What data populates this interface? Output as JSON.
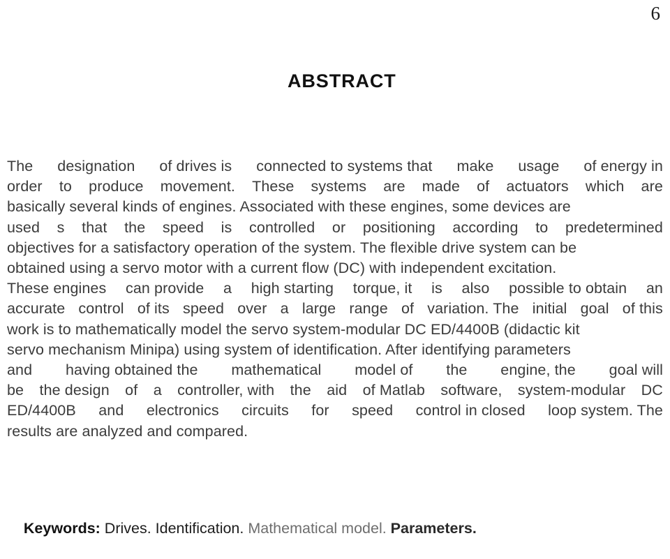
{
  "page": {
    "number": "6"
  },
  "heading": {
    "title": "ABSTRACT"
  },
  "abstract": {
    "lines": [
      "The   designation   of drives is   connected to systems that   make   usage   of energy in",
      "order  to  produce  movement.  These  systems  are  made  of  actuators  which  are",
      "basically several kinds of engines. Associated with these engines, some devices are",
      "used  s  that  the  speed  is  controlled  or  positioning  according  to  predetermined",
      "objectives for a satisfactory operation of the system. The flexible drive system can be",
      "obtained using a servo motor with a current flow (DC) with independent excitation.",
      "These engines  can provide  a  high starting  torque, it  is  also  possible to obtain  an",
      "accurate  control  of its  speed  over  a  large  range  of  variation. The  initial  goal  of this",
      "work is to mathematically model the servo system-modular DC ED/4400B (didactic kit",
      "servo mechanism Minipa) using system of identification. After identifying parameters",
      "and   having obtained the   mathematical   model of   the   engine, the   goal will",
      "be  the design  of  a  controller, with  the  aid  of Matlab  software,  system-modular  DC",
      "ED/4400B  and  electronics  circuits   for  speed  control in closed  loop system. The",
      "results are analyzed and compared."
    ],
    "justified_words": {
      "line1": [
        "The",
        "designation",
        "of drives is",
        "connected to systems that",
        "make",
        "usage",
        "of energy in"
      ],
      "line2": [
        "order",
        "to",
        "produce",
        "movement.",
        "These",
        "systems",
        "are",
        "made",
        "of",
        "actuators",
        "which",
        "are"
      ],
      "line4": [
        "used",
        "s",
        "that",
        "the",
        "speed",
        "is",
        "controlled",
        "or",
        "positioning",
        "according",
        "to",
        "predetermined"
      ],
      "line7": [
        "These engines",
        "can provide",
        "a",
        "high starting",
        "torque, it",
        "is",
        "also",
        "possible to obtain",
        "an"
      ],
      "line8": [
        "accurate",
        "control",
        "of its",
        "speed",
        "over",
        "a",
        "large",
        "range",
        "of",
        "variation. The",
        "initial",
        "goal",
        "of this"
      ],
      "line11": [
        "and",
        "having obtained the",
        "mathematical",
        "model of",
        "the",
        "engine, the",
        "goal will"
      ],
      "line12": [
        "be",
        "the design",
        "of",
        "a",
        "controller, with",
        "the",
        "aid",
        "of Matlab",
        "software,",
        "system-modular",
        "DC"
      ],
      "line13": [
        "ED/4400B",
        "and",
        "electronics",
        "circuits",
        "for",
        "speed",
        "control in closed",
        "loop system. The"
      ]
    }
  },
  "keywords": {
    "label": "Keywords:",
    "term_1": " Drives. Identification.",
    "term_2": " Mathematical model.",
    "term_3": " Parameters."
  },
  "colors": {
    "page_background": "#ffffff",
    "body_text": "#3b3b3b",
    "heading_text": "#111111",
    "keyword_faint": "#6e6e6e"
  }
}
